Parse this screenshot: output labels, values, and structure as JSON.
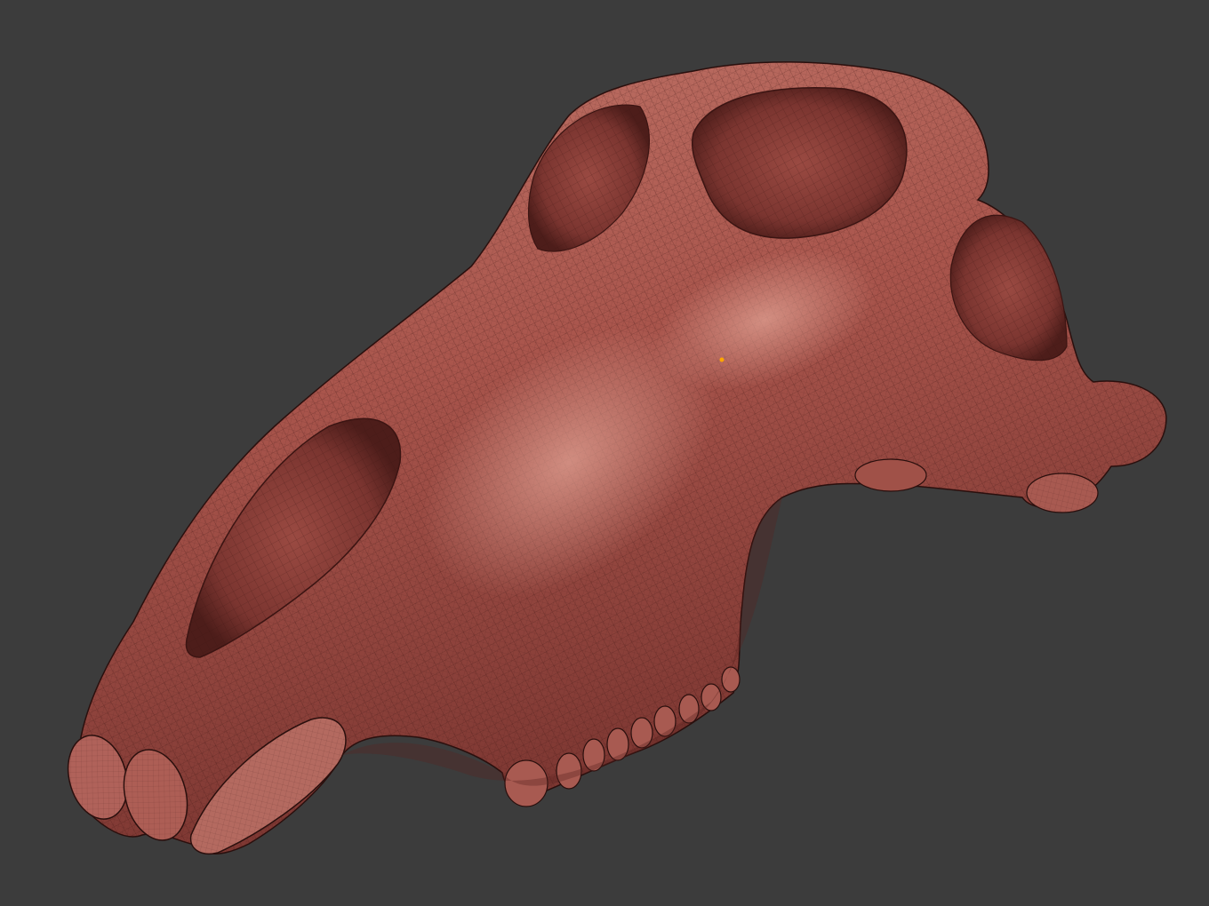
{
  "viewport": {
    "background_color": "#3c3c3c",
    "model": {
      "subject": "skull-mesh",
      "base_color": "#a9554c",
      "highlight_color": "#cf8f82",
      "shadow_color": "#5a2320",
      "wire_color": "#3b1412",
      "display_mode": "shaded-wireframe"
    },
    "pivot_marker": {
      "color": "#ffa600"
    }
  }
}
